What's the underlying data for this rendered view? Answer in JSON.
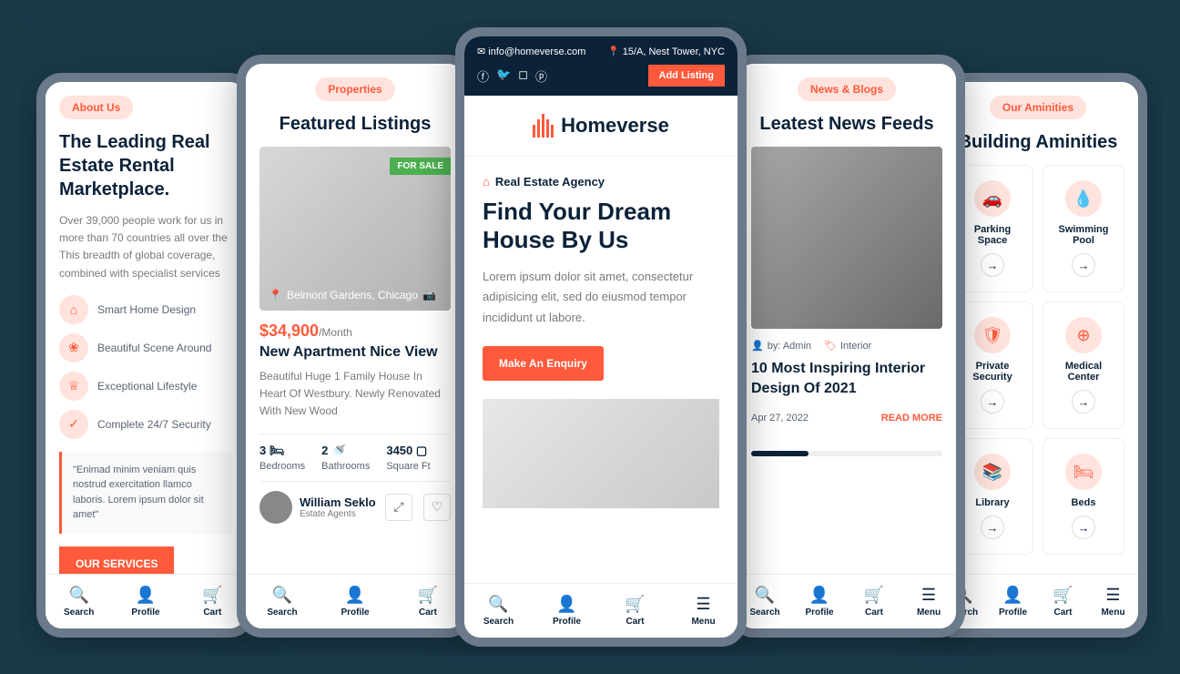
{
  "p1": {
    "badge": "About Us",
    "title": "The Leading Real Estate Rental Marketplace.",
    "subtitle": "Over 39,000 people work for us in more than 70 countries all over the This breadth of global coverage, combined with specialist services",
    "features": [
      "Smart Home Design",
      "Beautiful Scene Around",
      "Exceptional Lifestyle",
      "Complete 24/7 Security"
    ],
    "quote": "\"Enimad minim veniam quis nostrud exercitation llamco laboris. Lorem ipsum dolor sit amet\"",
    "cta": "OUR SERVICES"
  },
  "p2": {
    "badge": "Properties",
    "title": "Featured Listings",
    "img_badge": "FOR SALE",
    "location": "Belmont Gardens, Chicago",
    "price": "$34,900",
    "price_suffix": "/Month",
    "listing_title": "New Apartment Nice View",
    "desc": "Beautiful Huge 1 Family House In Heart Of Westbury. Newly Renovated With New Wood",
    "specs": [
      {
        "val": "3",
        "icon": "🛏",
        "label": "Bedrooms"
      },
      {
        "val": "2",
        "icon": "🚿",
        "label": "Bathrooms"
      },
      {
        "val": "3450",
        "icon": "▢",
        "label": "Square Ft"
      }
    ],
    "agent_name": "William Seklo",
    "agent_role": "Estate Agents"
  },
  "p3": {
    "email": "info@homeverse.com",
    "address": "15/A, Nest Tower, NYC",
    "add_listing": "Add Listing",
    "brand": "Homeverse",
    "agency": "Real Estate Agency",
    "hero_title": "Find Your Dream House By Us",
    "hero_text": "Lorem ipsum dolor sit amet, consectetur adipisicing elit, sed do eiusmod tempor incididunt ut labore.",
    "cta": "Make An Enquiry"
  },
  "p4": {
    "badge": "News & Blogs",
    "title": "Leatest News Feeds",
    "author": "by: Admin",
    "category": "Interior",
    "news_title": "10 Most Inspiring Interior Design Of 2021",
    "date": "Apr 27, 2022",
    "read_more": "READ MORE"
  },
  "p5": {
    "badge": "Our Aminities",
    "title": "Building Aminities",
    "items": [
      {
        "icon": "🚗",
        "label": "Parking Space"
      },
      {
        "icon": "💧",
        "label": "Swimming Pool"
      },
      {
        "icon": "🛡",
        "label": "Private Security"
      },
      {
        "icon": "⊕",
        "label": "Medical Center"
      },
      {
        "icon": "📚",
        "label": "Library"
      },
      {
        "icon": "🛏",
        "label": "Beds"
      }
    ]
  },
  "nav": {
    "search": "Search",
    "profile": "Profile",
    "cart": "Cart",
    "menu": "Menu"
  }
}
